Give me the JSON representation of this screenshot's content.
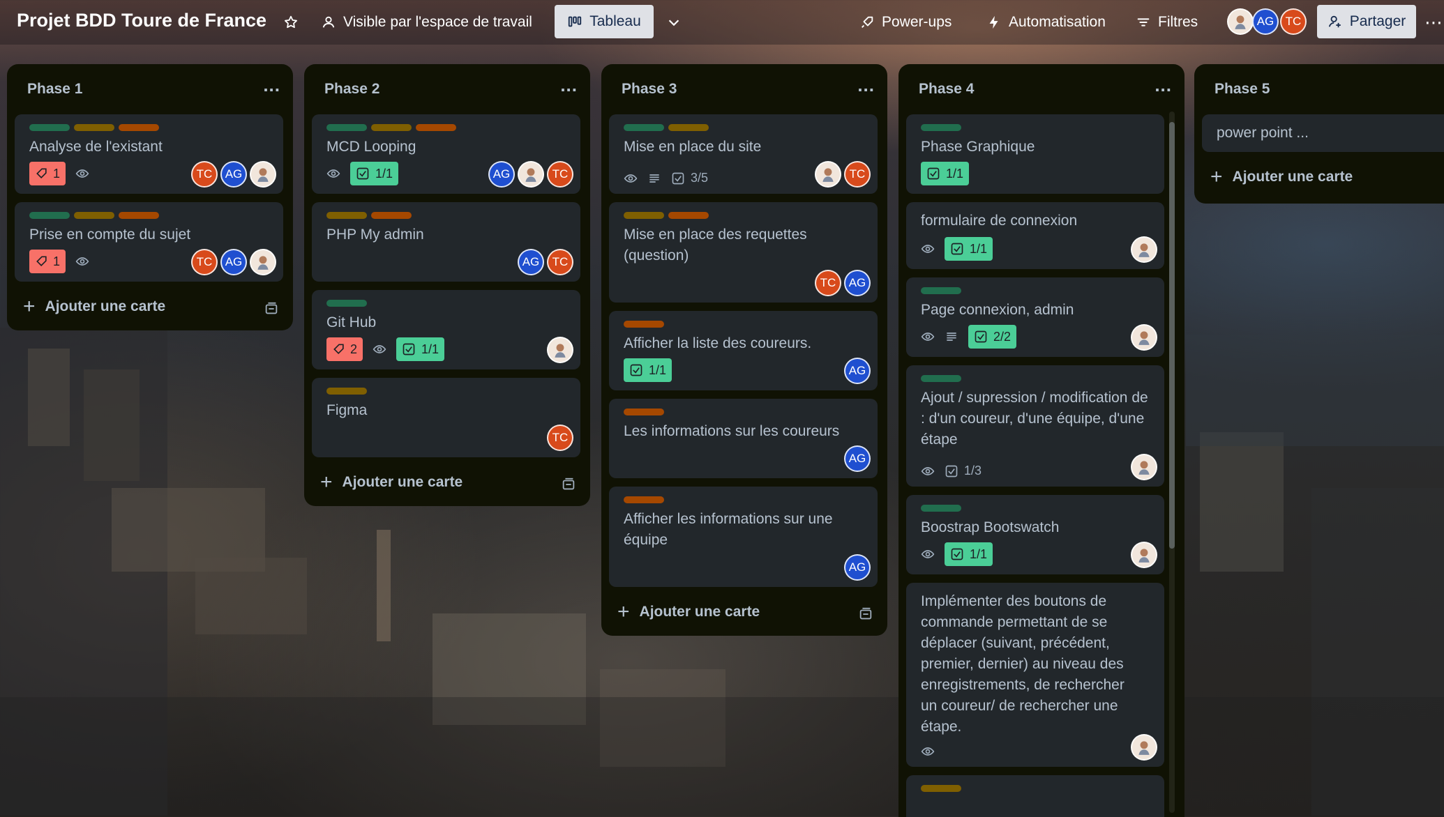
{
  "header": {
    "board_title": "Projet BDD Toure de France",
    "visibility": "Visible par l'espace de travail",
    "view": "Tableau",
    "powerups": "Power-ups",
    "automation": "Automatisation",
    "filters": "Filtres",
    "share": "Partager",
    "members": [
      "AG",
      "TC"
    ]
  },
  "colors": {
    "label_green": "#216e4e",
    "label_olive": "#7f5f01",
    "label_orange": "#a54800",
    "list_bg": "#101204",
    "card_bg": "#22272b",
    "avatar_tc": "#d84a1b",
    "avatar_ag": "#1f4fd0"
  },
  "add_card": "Ajouter une carte",
  "lists": [
    {
      "title": "Phase 1",
      "cards": [
        {
          "title": "Analyse de l'existant",
          "attachments": "1"
        },
        {
          "title": "Prise en compte du sujet",
          "attachments": "1"
        }
      ]
    },
    {
      "title": "Phase 2",
      "cards": [
        {
          "title": "MCD Looping",
          "checklist": "1/1"
        },
        {
          "title": "PHP My admin"
        },
        {
          "title": "Git Hub",
          "attachments": "2",
          "checklist": "1/1"
        },
        {
          "title": "Figma"
        }
      ]
    },
    {
      "title": "Phase 3",
      "cards": [
        {
          "title": "Mise en place du site",
          "checklist": "3/5"
        },
        {
          "title": "Mise en place des requettes (question)"
        },
        {
          "title": "Afficher la liste des coureurs.",
          "checklist": "1/1"
        },
        {
          "title": "Les informations sur les coureurs"
        },
        {
          "title": "Afficher les informations sur une équipe"
        }
      ]
    },
    {
      "title": "Phase 4",
      "cards": [
        {
          "title": "Phase Graphique",
          "checklist": "1/1"
        },
        {
          "title": "formulaire de connexion",
          "checklist": "1/1"
        },
        {
          "title": "Page connexion, admin",
          "checklist": "2/2"
        },
        {
          "title": "Ajout / supression / modification de : d'un coureur, d'une équipe, d'une étape",
          "checklist": "1/3"
        },
        {
          "title": "Boostrap Bootswatch",
          "checklist": "1/1"
        },
        {
          "title": "Implémenter des boutons de commande permettant de se déplacer (suivant, précédent, premier, dernier) au niveau des enregistrements, de rechercher un coureur/ de rechercher une étape."
        }
      ]
    },
    {
      "title": "Phase 5",
      "cards": [
        {
          "title": "power point ..."
        }
      ]
    }
  ]
}
